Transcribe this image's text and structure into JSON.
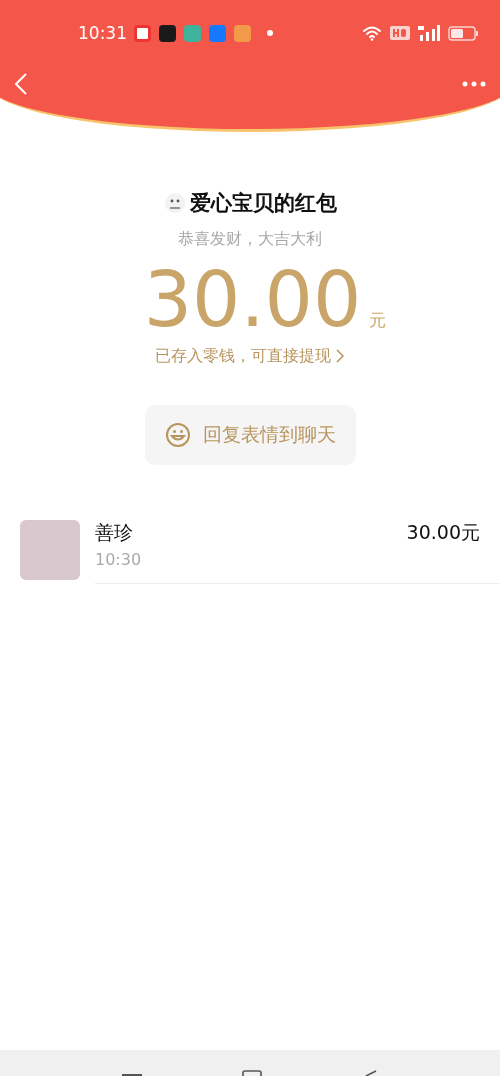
{
  "status_bar": {
    "time": "10:31"
  },
  "packet": {
    "sender": "爱心宝贝的红包",
    "greeting": "恭喜发财，大吉大利",
    "amount": "30.00",
    "unit": "元",
    "note": "已存入零钱，可直接提现"
  },
  "reply_button": {
    "label": "回复表情到聊天"
  },
  "receivers": [
    {
      "name": "善珍",
      "time": "10:30",
      "amount": "30.00元"
    }
  ]
}
